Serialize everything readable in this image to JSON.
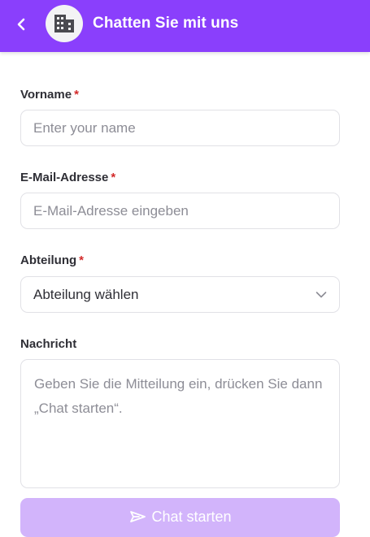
{
  "header": {
    "title": "Chatten Sie mit uns",
    "back_icon": "chevron-left-icon",
    "avatar_icon": "building-icon",
    "color": "#8a3ffc"
  },
  "form": {
    "required_marker": "*",
    "first_name": {
      "label": "Vorname",
      "placeholder": "Enter your name",
      "value": ""
    },
    "email": {
      "label": "E-Mail-Adresse",
      "placeholder": "E-Mail-Adresse eingeben",
      "value": ""
    },
    "department": {
      "label": "Abteilung",
      "selected": "Abteilung wählen"
    },
    "message": {
      "label": "Nachricht",
      "placeholder": "Geben Sie die Mitteilung ein, drücken Sie dann „Chat starten“.",
      "value": ""
    },
    "submit": {
      "label": "Chat starten",
      "icon": "send-icon",
      "color": "#d2b4fb"
    }
  }
}
